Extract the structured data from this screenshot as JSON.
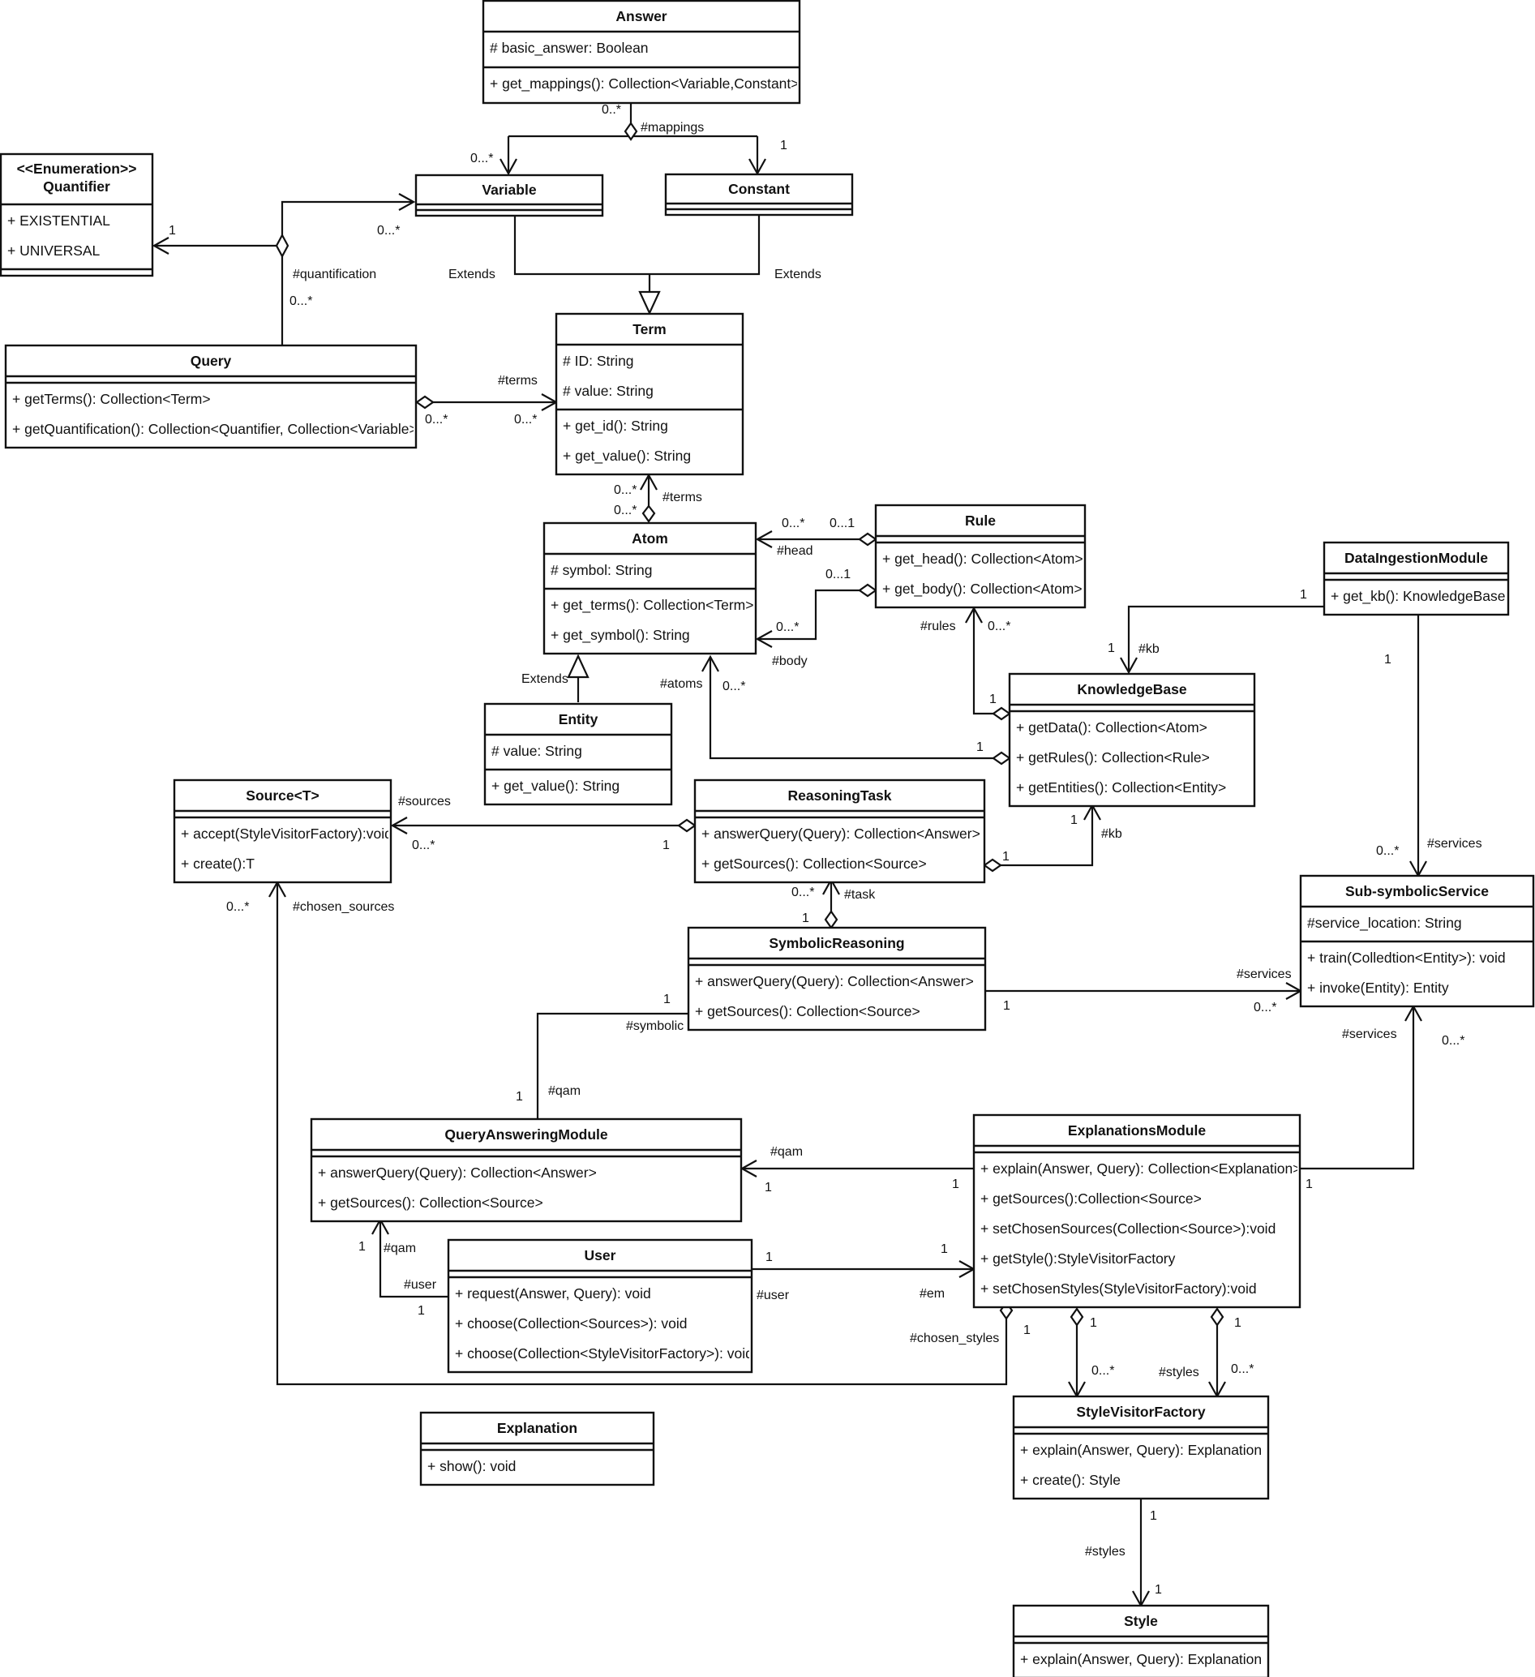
{
  "diagram": {
    "type": "UML class diagram",
    "classes": {
      "answer": {
        "name": "Answer",
        "attributes": [
          "# basic_answer: Boolean"
        ],
        "methods": [
          "+ get_mappings(): Collection<Variable,Constant>"
        ]
      },
      "quantifier": {
        "stereotype": "<<Enumeration>>",
        "name": "Quantifier",
        "attributes": [
          "+ EXISTENTIAL",
          "+ UNIVERSAL"
        ],
        "methods": []
      },
      "variable": {
        "name": "Variable",
        "attributes": [],
        "methods": []
      },
      "constant": {
        "name": "Constant",
        "attributes": [],
        "methods": []
      },
      "query": {
        "name": "Query",
        "attributes": [],
        "methods": [
          "+ getTerms(): Collection<Term>",
          "+ getQuantification(): Collection<Quantifier, Collection<Variable>"
        ]
      },
      "term": {
        "name": "Term",
        "attributes": [
          "# ID: String",
          "# value: String"
        ],
        "methods": [
          "+ get_id(): String",
          "+ get_value(): String"
        ]
      },
      "atom": {
        "name": "Atom",
        "attributes": [
          "# symbol: String"
        ],
        "methods": [
          "+ get_terms(): Collection<Term>",
          "+ get_symbol(): String"
        ]
      },
      "rule": {
        "name": "Rule",
        "attributes": [],
        "methods": [
          "+ get_head(): Collection<Atom>",
          "+ get_body(): Collection<Atom>"
        ]
      },
      "data_ingestion_module": {
        "name": "DataIngestionModule",
        "attributes": [],
        "methods": [
          "+ get_kb(): KnowledgeBase"
        ]
      },
      "knowledge_base": {
        "name": "KnowledgeBase",
        "attributes": [],
        "methods": [
          "+ getData(): Collection<Atom>",
          "+ getRules(): Collection<Rule>",
          "+ getEntities(): Collection<Entity>"
        ]
      },
      "entity": {
        "name": "Entity",
        "attributes": [
          "# value: String"
        ],
        "methods": [
          "+ get_value(): String"
        ]
      },
      "source": {
        "name": "Source<T>",
        "attributes": [],
        "methods": [
          "+ accept(StyleVisitorFactory):void",
          "+ create():T"
        ]
      },
      "reasoning_task": {
        "name": "ReasoningTask",
        "attributes": [],
        "methods": [
          "+ answerQuery(Query): Collection<Answer>",
          "+ getSources(): Collection<Source>"
        ]
      },
      "symbolic_reasoning": {
        "name": "SymbolicReasoning",
        "attributes": [],
        "methods": [
          "+ answerQuery(Query): Collection<Answer>",
          "+ getSources(): Collection<Source>"
        ]
      },
      "sub_symbolic_service": {
        "name": "Sub-symbolicService",
        "attributes": [
          "#service_location: String"
        ],
        "methods": [
          "+ train(Colledtion<Entity>): void",
          "+ invoke(Entity): Entity"
        ]
      },
      "query_answering_module": {
        "name": "QueryAnsweringModule",
        "attributes": [],
        "methods": [
          "+ answerQuery(Query): Collection<Answer>",
          "+ getSources(): Collection<Source>"
        ]
      },
      "explanations_module": {
        "name": "ExplanationsModule",
        "attributes": [],
        "methods": [
          "+ explain(Answer, Query): Collection<Explanation>",
          "+ getSources():Collection<Source>",
          "+ setChosenSources(Collection<Source>):void",
          "+ getStyle():StyleVisitorFactory",
          "+ setChosenStyles(StyleVisitorFactory):void"
        ]
      },
      "user": {
        "name": "User",
        "attributes": [],
        "methods": [
          "+ request(Answer, Query): void",
          "+ choose(Collection<Sources>): void",
          "+ choose(Collection<StyleVisitorFactory>): void"
        ]
      },
      "explanation": {
        "name": "Explanation",
        "attributes": [],
        "methods": [
          "+ show(): void"
        ]
      },
      "style_visitor_factory": {
        "name": "StyleVisitorFactory",
        "attributes": [],
        "methods": [
          "+ explain(Answer, Query): Explanation",
          "+ create(): Style"
        ]
      },
      "style": {
        "name": "Style",
        "attributes": [],
        "methods": [
          "+ explain(Answer, Query): Explanation"
        ]
      }
    },
    "labels": {
      "answer_mult": "0..*",
      "mappings": "#mappings",
      "variable_mult": "0...*",
      "constant_mult": "1",
      "quant_mult_1": "1",
      "quant_var_mult": "0...*",
      "quantification": "#quantification",
      "quant_query_mult": "0...*",
      "extends_left": "Extends",
      "extends_right": "Extends",
      "query_terms_role": "#terms",
      "query_terms_src": "0...*",
      "query_terms_dst": "0...*",
      "atom_terms_dst": "0...*",
      "atom_terms_src": "0...*",
      "atom_terms_role": "#terms",
      "head_dst": "0...*",
      "head_src": "0...1",
      "head_role": "#head",
      "body_src": "0...1",
      "body_dst": "0...*",
      "body_role": "#body",
      "entity_extends": "Extends",
      "atoms_role": "#atoms",
      "atoms_dst": "0...*",
      "rules_role": "#rules",
      "rules_dst": "0...*",
      "kb_rules_src": "1",
      "kb_atoms_src": "1",
      "dim_kb_src": "1",
      "dim_kb_dst": "1",
      "dim_kb_role": "#kb",
      "dim_svc_src": "1",
      "dim_svc_dst": "0...*",
      "dim_svc_role": "#services",
      "sources_role": "#sources",
      "sources_dst": "0...*",
      "sources_src": "1",
      "rt_kb_dst": "1",
      "rt_kb_role": "#kb",
      "rt_kb_src": "1",
      "task_dst": "0...*",
      "task_role": "#task",
      "task_src": "1",
      "chosen_sources_dst": "0...*",
      "chosen_sources_role": "#chosen_sources",
      "sr_svc_role": "#services",
      "sr_svc_dst": "0...*",
      "sr_svc_src": "1",
      "symbolic_src": "1",
      "symbolic_role": "#symbolic",
      "qam_sym_mult": "1",
      "qam_sym_role": "#qam",
      "em_svc_role": "#services",
      "em_svc_dst": "0...*",
      "em_svc_src": "1",
      "em_qam_role": "#qam",
      "em_qam_dst": "1",
      "em_qam_src": "1",
      "user_qam_dst": "1",
      "user_qam_role": "#qam",
      "user_qam_user_role": "#user",
      "user_qam_src": "1",
      "user_em_src": "1",
      "user_em_user_role": "#user",
      "user_em_dst": "1",
      "user_em_role": "#em",
      "chosen_styles_role": "#chosen_styles",
      "chosen_styles_src": "1",
      "em_svf_src": "1",
      "em_svf_dst": "0...*",
      "styles_role": "#styles",
      "styles_src": "1",
      "styles_dst": "0...*",
      "svf_style_src": "1",
      "svf_style_role": "#styles",
      "svf_style_dst": "1"
    }
  }
}
